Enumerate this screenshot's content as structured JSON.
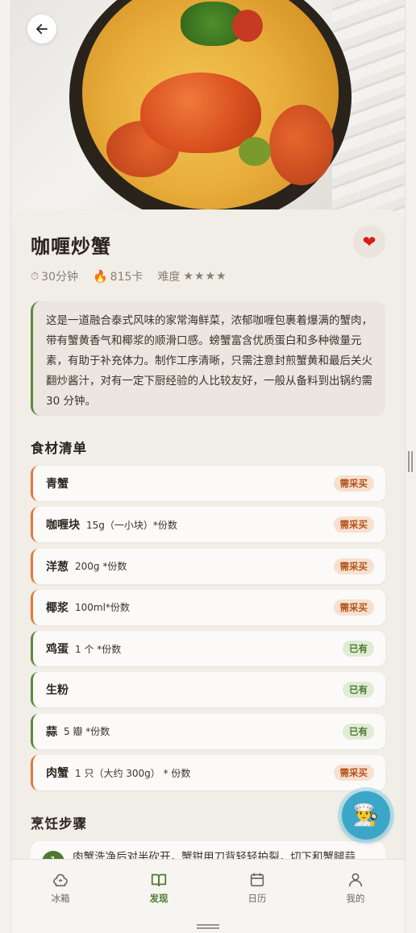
{
  "hero": {
    "back_icon": "arrow-left-icon"
  },
  "recipe": {
    "title": "咖喱炒蟹",
    "favorite_icon": "heart-icon",
    "time": "30分钟",
    "calories": "815卡",
    "difficulty_label": "难度",
    "difficulty_stars": "★★★★",
    "description": "这是一道融合泰式风味的家常海鲜菜，浓郁咖喱包裹着爆满的蟹肉，带有蟹黄香气和椰浆的顺滑口感。螃蟹富含优质蛋白和多种微量元素，有助于补充体力。制作工序清晰，只需注意封煎蟹黄和最后关火翻炒酱汁，对有一定下厨经验的人比较友好，一般从备料到出锅约需 30 分钟。"
  },
  "ingredients": {
    "title": "食材清单",
    "items": [
      {
        "name": "青蟹",
        "qty": "",
        "status": "需采买",
        "kind": "need"
      },
      {
        "name": "咖喱块",
        "qty": "15g（一小块）*份数",
        "status": "需采买",
        "kind": "need"
      },
      {
        "name": "洋葱",
        "qty": "200g *份数",
        "status": "需采买",
        "kind": "need"
      },
      {
        "name": "椰浆",
        "qty": "100ml*份数",
        "status": "需采买",
        "kind": "need"
      },
      {
        "name": "鸡蛋",
        "qty": "1 个 *份数",
        "status": "已有",
        "kind": "have"
      },
      {
        "name": "生粉",
        "qty": "",
        "status": "已有",
        "kind": "have"
      },
      {
        "name": "蒜",
        "qty": "5 瓣 *份数",
        "status": "已有",
        "kind": "have"
      },
      {
        "name": "肉蟹",
        "qty": "1 只（大约 300g） * 份数",
        "status": "需采买",
        "kind": "need"
      }
    ]
  },
  "steps": {
    "title": "烹饪步骤",
    "first_step_partial": "肉蟹洗净后对半砍开，蟹钳用刀背轻轻拍裂，切下和蟹腿蒜"
  },
  "fab": {
    "icon": "chef-icon"
  },
  "nav": {
    "items": [
      {
        "label": "冰箱",
        "icon": "fridge-icon"
      },
      {
        "label": "发现",
        "icon": "book-icon"
      },
      {
        "label": "日历",
        "icon": "calendar-icon"
      },
      {
        "label": "我的",
        "icon": "user-icon"
      }
    ],
    "active_index": 1
  },
  "colors": {
    "accent_green": "#4e7a30",
    "need_orange": "#e07a3a",
    "background": "#f1ede7"
  }
}
